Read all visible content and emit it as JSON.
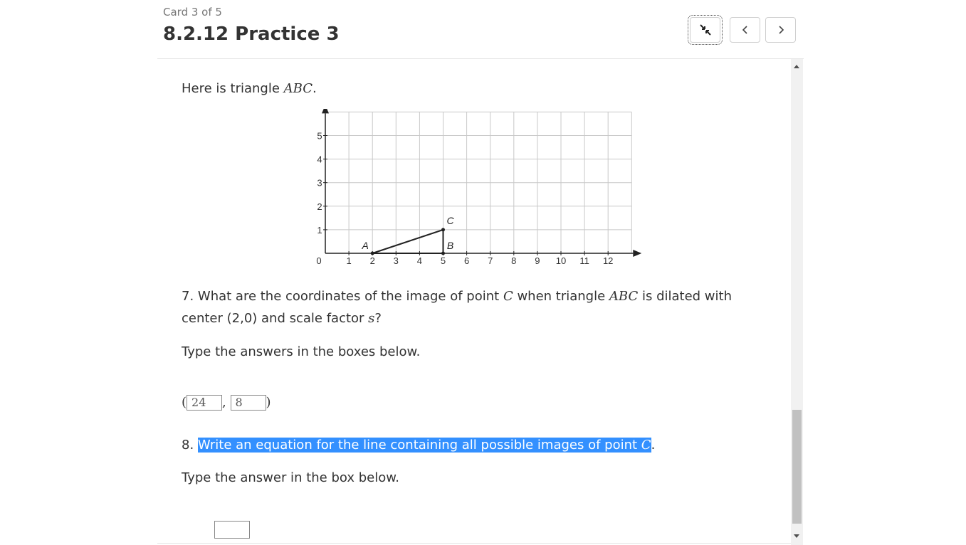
{
  "header": {
    "card_counter": "Card 3 of 5",
    "title": "8.2.12 Practice 3",
    "buttons": {
      "collapse_icon": "collapse-arrows-icon",
      "prev_icon": "chevron-left-icon",
      "next_icon": "chevron-right-icon"
    }
  },
  "problem": {
    "intro_text": "Here is triangle ",
    "intro_var": "ABC",
    "intro_end": ".",
    "graph": {
      "x_ticks": [
        "1",
        "2",
        "3",
        "4",
        "5",
        "6",
        "7",
        "8",
        "9",
        "10",
        "11",
        "12"
      ],
      "y_ticks": [
        "1",
        "2",
        "3",
        "4",
        "5"
      ],
      "origin_label": "0",
      "points": [
        {
          "label": "A",
          "x": 2,
          "y": 0
        },
        {
          "label": "B",
          "x": 5,
          "y": 0
        },
        {
          "label": "C",
          "x": 5,
          "y": 1
        }
      ]
    },
    "q7": {
      "part1": "7. What are the coordinates of the image of point ",
      "var_c": "C",
      "part2": " when triangle ",
      "var_abc": "ABC",
      "part3": " is dilated with",
      "line2_a": "center (2,0) and scale factor ",
      "var_s": "s",
      "line2_b": "?",
      "instruction": "Type the answers in the boxes below.",
      "open_paren": "(",
      "comma": ",",
      "close_paren": ")",
      "answer_x": "24",
      "answer_y": "8"
    },
    "q8": {
      "number": "8. ",
      "text": "Write an equation for the line containing all possible images of point ",
      "var_c": "C",
      "end": ".",
      "instruction": "Type the answer in the box below.",
      "answer": ""
    }
  },
  "colors": {
    "highlight": "#3390ff",
    "text": "#333333",
    "grid": "#c8c8c8"
  }
}
